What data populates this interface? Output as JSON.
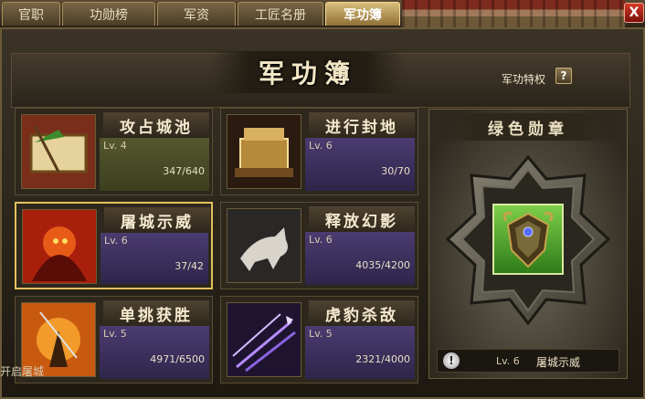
{
  "tabs": [
    {
      "label": "官职",
      "active": false
    },
    {
      "label": "功勋榜",
      "active": false
    },
    {
      "label": "军资",
      "active": false
    },
    {
      "label": "工匠名册",
      "active": false
    },
    {
      "label": "军功簿",
      "active": true
    }
  ],
  "close_label": "X",
  "panel": {
    "title": "军功簿",
    "privilege_label": "军功特权",
    "help_label": "?"
  },
  "cards": [
    {
      "name": "攻占城池",
      "level": "Lv. 4",
      "progress": "347/640",
      "current": 347,
      "max": 640,
      "theme": "green",
      "icon": "scroll-banner-icon"
    },
    {
      "name": "进行封地",
      "level": "Lv. 6",
      "progress": "30/70",
      "current": 30,
      "max": 70,
      "theme": "purple",
      "icon": "treasure-chest-icon"
    },
    {
      "name": "屠城示威",
      "level": "Lv. 6",
      "progress": "37/42",
      "current": 37,
      "max": 42,
      "theme": "purple",
      "icon": "fire-warrior-icon",
      "selected": true
    },
    {
      "name": "释放幻影",
      "level": "Lv. 6",
      "progress": "4035/4200",
      "current": 4035,
      "max": 4200,
      "theme": "purple",
      "icon": "phantom-horse-icon"
    },
    {
      "name": "单挑获胜",
      "level": "Lv. 5",
      "progress": "4971/6500",
      "current": 4971,
      "max": 6500,
      "theme": "purple",
      "icon": "duel-warrior-icon"
    },
    {
      "name": "虎豹杀敌",
      "level": "Lv. 5",
      "progress": "2321/4000",
      "current": 2321,
      "max": 4000,
      "theme": "purple",
      "icon": "arrows-icon"
    }
  ],
  "badge": {
    "title": "绿色勋章",
    "level": "Lv. 6",
    "name": "屠城示威",
    "icon": "green-medal-icon",
    "info_icon": "!"
  },
  "bottom_text": "开启屠城"
}
